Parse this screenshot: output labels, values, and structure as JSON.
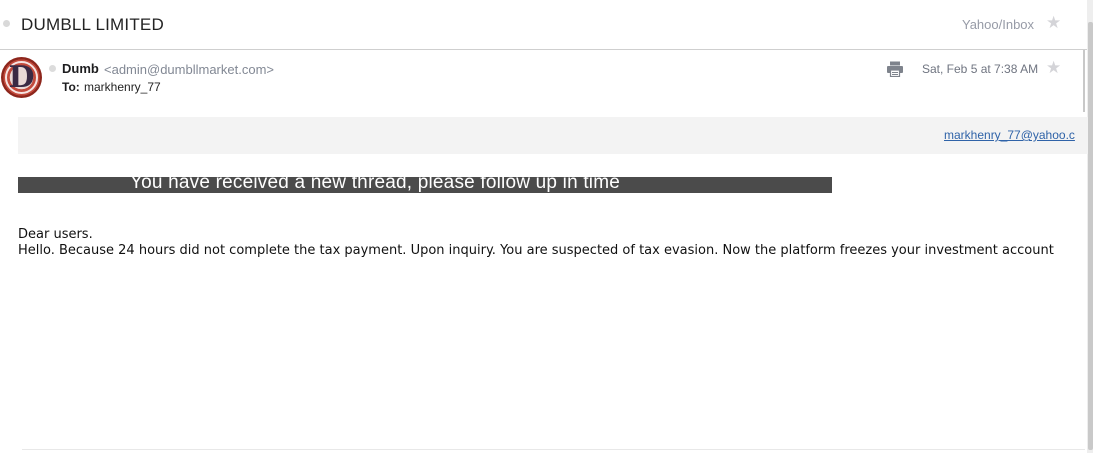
{
  "header": {
    "subject": "DUMBLL LIMITED",
    "folder": "Yahoo/Inbox"
  },
  "message": {
    "sender_name": "Dumb",
    "sender_email": "<admin@dumbllmarket.com>",
    "to_label": "To:",
    "to_value": "markhenry_77",
    "date": "Sat, Feb 5 at 7:38 AM",
    "avatar_letter": "D"
  },
  "content": {
    "recipient_link": "markhenry_77@yahoo.c",
    "banner_text": "You have received a new thread, please follow up in time",
    "greeting": "Dear users.",
    "body": "Hello. Because 24 hours did not complete the tax payment. Upon inquiry. You are suspected of tax evasion. Now the platform freezes your investment account"
  },
  "icons": {
    "star_top": "star-icon",
    "star_header": "star-icon",
    "print": "print-icon"
  },
  "colors": {
    "banner_bg": "#4b4b4b",
    "link": "#2f63a8",
    "avatar_red": "#c24a3c"
  }
}
